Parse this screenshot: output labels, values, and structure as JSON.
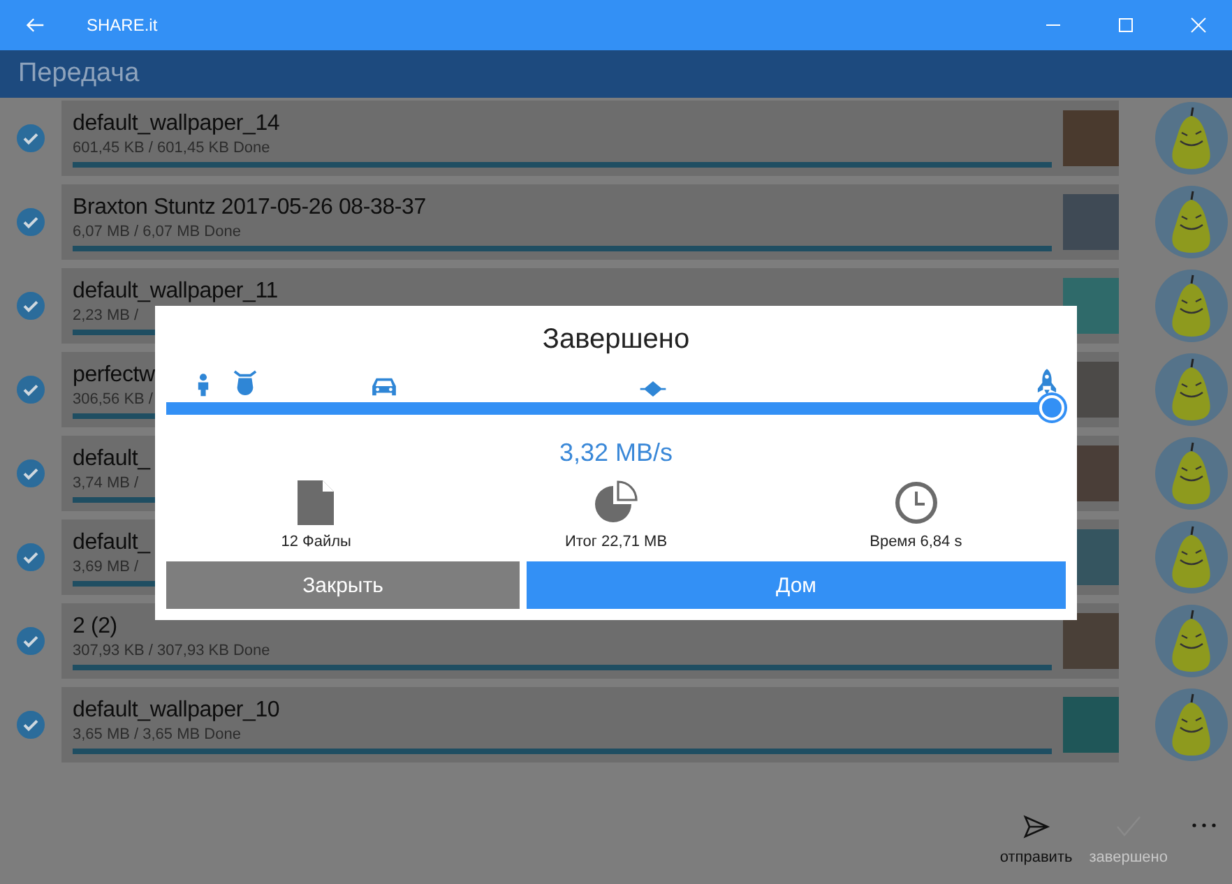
{
  "window": {
    "title": "SHARE.it"
  },
  "header": {
    "title": "Передача"
  },
  "transfers": [
    {
      "title": "default_wallpaper_14",
      "detail": "601,45  KB / 601,45  KB Done",
      "checked": true,
      "level": 1
    },
    {
      "title": "Braxton Stuntz  2017-05-26 08-38-37",
      "detail": "6,07  MB / 6,07  MB Done",
      "checked": true,
      "level": 1
    },
    {
      "title": "default_wallpaper_11",
      "detail": "2,23  MB /",
      "checked": true,
      "level": 1
    },
    {
      "title": "perfectw",
      "detail": "306,56  KB /",
      "checked": true,
      "level": 1
    },
    {
      "title": "default_",
      "detail": "3,74  MB /",
      "checked": true,
      "level": 1
    },
    {
      "title": "default_",
      "detail": "3,69  MB /",
      "checked": true,
      "level": 1
    },
    {
      "title": "2 (2)",
      "detail": "307,93  KB / 307,93  KB Done",
      "checked": true,
      "level": 1
    },
    {
      "title": "default_wallpaper_10",
      "detail": "3,65  MB / 3,65  MB Done",
      "checked": true,
      "level": 1
    }
  ],
  "dialog": {
    "title": "Завершено",
    "speed": {
      "level": 1
    },
    "speed_reading": "3,32  MB/s",
    "stats": [
      {
        "kind": "files",
        "label": "12 Файлы"
      },
      {
        "kind": "total",
        "label": "Итог 22,71  MB"
      },
      {
        "kind": "time",
        "label": "Время 6,84 s"
      }
    ],
    "buttons": [
      {
        "label": "Закрыть",
        "kind": "secondary"
      },
      {
        "label": "Дом",
        "kind": "primary"
      }
    ]
  },
  "bottom_bar": [
    {
      "kind": "send",
      "label": "отправить",
      "disabled": false
    },
    {
      "kind": "done",
      "label": "завершено",
      "disabled": true
    },
    {
      "kind": "more"
    }
  ]
}
